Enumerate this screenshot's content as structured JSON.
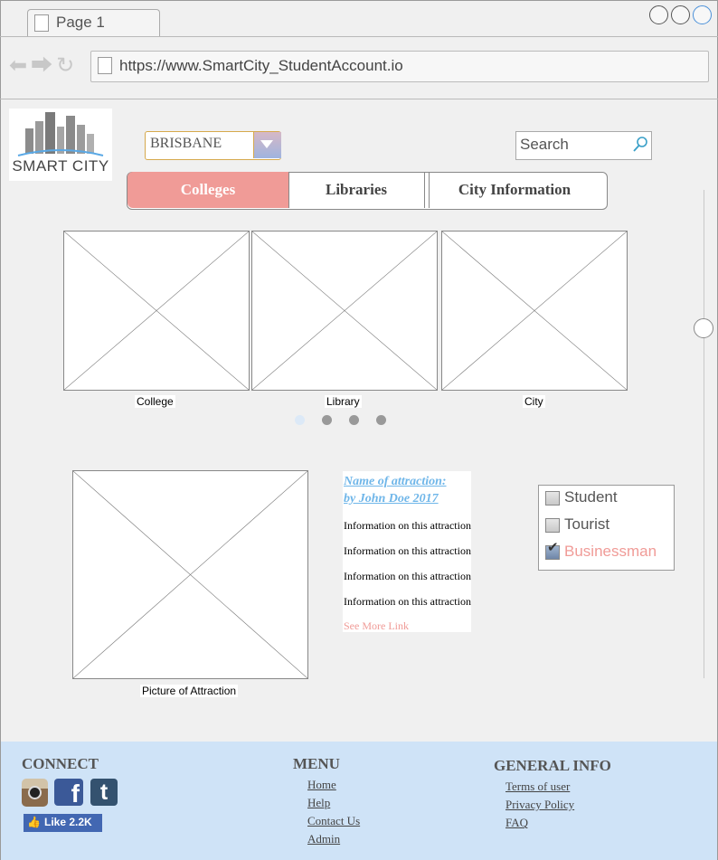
{
  "browser": {
    "tab_title": "Page 1",
    "url": "https://www.SmartCity_StudentAccount.io"
  },
  "header": {
    "logo_text": "SMART CITY",
    "city_select": {
      "value": "BRISBANE"
    },
    "search": {
      "placeholder": "Search"
    }
  },
  "nav_tabs": [
    {
      "label": "Colleges",
      "active": true
    },
    {
      "label": "Libraries",
      "active": false
    },
    {
      "label": "City Information",
      "active": false
    }
  ],
  "carousel": {
    "captions": [
      "College",
      "Library",
      "City"
    ],
    "dots": 4,
    "active_dot": 1
  },
  "attraction": {
    "image_caption": "Picture of Attraction",
    "name_line1": "Name of attraction:",
    "name_line2": "by John Doe 2017",
    "info": [
      "Information on this attraction",
      "Information on this attraction",
      "Information on this attraction",
      "Information on this attraction"
    ],
    "see_more": "See More Link"
  },
  "user_types": [
    {
      "label": "Student",
      "checked": false
    },
    {
      "label": "Tourist",
      "checked": false
    },
    {
      "label": "Businessman",
      "checked": true
    }
  ],
  "footer": {
    "connect": {
      "heading": "CONNECT",
      "icons": [
        "instagram-icon",
        "facebook-icon",
        "tumblr-icon"
      ],
      "like_label": "Like 2.2K"
    },
    "menu": {
      "heading": "MENU",
      "links": [
        "Home",
        "Help",
        "Contact Us",
        "Admin"
      ]
    },
    "general_info": {
      "heading": "GENERAL INFO",
      "links": [
        "Terms of user",
        "Privacy Policy",
        "FAQ"
      ]
    }
  },
  "colors": {
    "accent_pink": "#f09b97",
    "link_blue": "#6fb6e9",
    "footer_bg": "#cfe3f7"
  }
}
